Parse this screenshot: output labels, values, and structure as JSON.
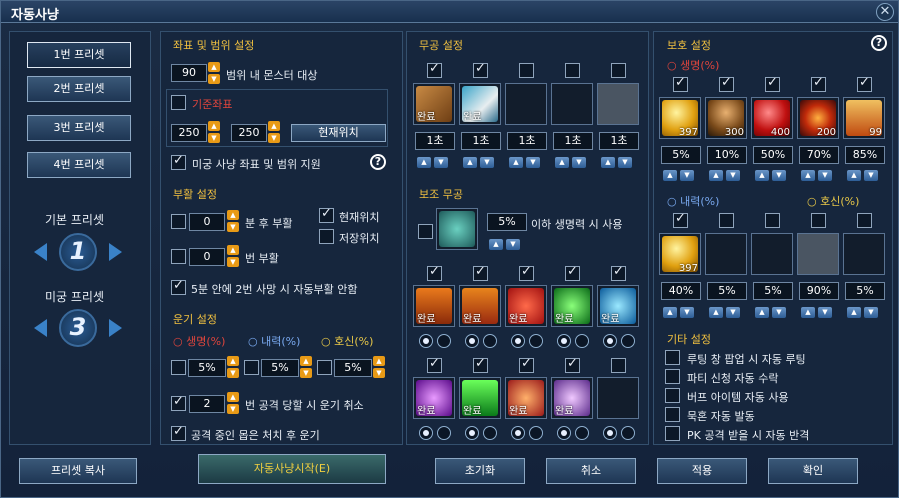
{
  "window": {
    "title": "자동사냥",
    "close": "✕"
  },
  "presets": {
    "items": [
      "1번 프리셋",
      "2번 프리셋",
      "3번 프리셋",
      "4번 프리셋"
    ],
    "basic_label": "기본 프리셋",
    "basic_value": "1",
    "miggung_label": "미궁 프리셋",
    "miggung_value": "3"
  },
  "range": {
    "title": "좌표 및 범위 설정",
    "range_value": "90",
    "range_label": "범위 내 몬스터 대상",
    "base_coord_label": "기준좌표",
    "x": "250",
    "y": "250",
    "current_pos_btn": "현재위치",
    "miggung_support": "미궁 사냥 좌표 및 범위 지원",
    "help": "?"
  },
  "revive": {
    "title": "부활 설정",
    "min_value": "0",
    "min_label": "분 후 부활",
    "times_value": "0",
    "times_label": "번 부활",
    "current_pos": "현재위치",
    "saved_pos": "저장위치",
    "auto_quit": "5분 안에 2번 사망 시 자동부활 안함"
  },
  "ungi": {
    "title": "운기 설정",
    "life": "○ 생명(%)",
    "inner": "○ 내력(%)",
    "guard": "○ 호신(%)",
    "v1": "5%",
    "v2": "5%",
    "v3": "5%",
    "cancel_value": "2",
    "cancel_label": "번 공격 당할 시 운기 취소",
    "after_label": "공격 중인 몹은 처치 후 운기"
  },
  "weapon": {
    "title": "무공 설정",
    "delays": [
      "1초",
      "1초",
      "1초",
      "1초",
      "1초"
    ],
    "done": "완료"
  },
  "aux": {
    "title": "보조 무공",
    "percent": "5%",
    "label": "이하 생명력 시 사용",
    "done": "완료"
  },
  "protect": {
    "title": "보호 설정",
    "life": "○ 생명(%)",
    "life_counts": [
      "397",
      "300",
      "400",
      "200",
      "99"
    ],
    "life_values": [
      "5%",
      "10%",
      "50%",
      "70%",
      "85%"
    ],
    "inner": "○ 내력(%)",
    "guard": "○ 호신(%)",
    "inner_count": "397",
    "inner_values": [
      "40%",
      "5%",
      "5%"
    ],
    "guard_values": [
      "90%",
      "5%"
    ],
    "help": "?"
  },
  "etc": {
    "title": "기타 설정",
    "items": [
      "루팅 창 팝업 시 자동 루팅",
      "파티 신청 자동 수락",
      "버프 아이템 자동 사용",
      "묵혼 자동 발동",
      "PK 공격 받을 시 자동 반격"
    ]
  },
  "footer": {
    "copy": "프리셋 복사",
    "start": "자동사냥시작(E)",
    "reset": "초기화",
    "cancel": "취소",
    "apply": "적용",
    "ok": "확인"
  },
  "colors": {
    "accent": "#f0c040",
    "red": "#e0453c",
    "blue": "#79a9f0"
  }
}
